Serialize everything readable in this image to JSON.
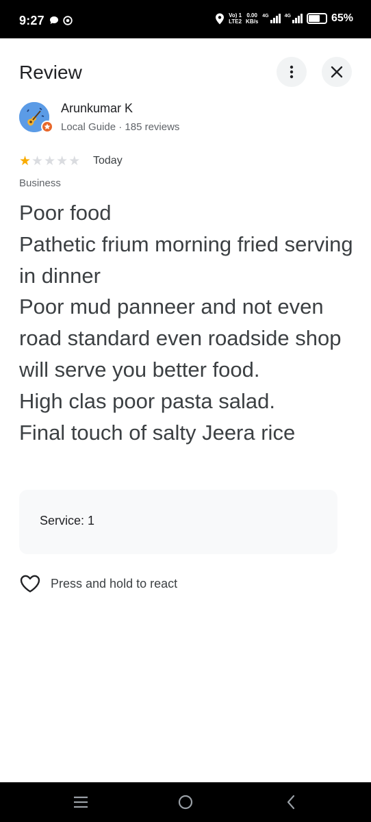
{
  "status_bar": {
    "time": "9:27",
    "volte_top": "Vo) 1",
    "volte_bottom": "LTE2",
    "speed_value": "0.00",
    "speed_unit": "KB/s",
    "net1": "4G",
    "net2": "4G",
    "battery_level": 0.65,
    "battery": "65%"
  },
  "header": {
    "title": "Review"
  },
  "author": {
    "name": "Arunkumar K",
    "meta": "Local Guide · 185 reviews"
  },
  "review": {
    "rating": 1,
    "max_rating": 5,
    "date": "Today",
    "visit_type": "Business",
    "text": "Poor food\nPathetic frium morning fried serving in dinner\nPoor mud panneer and not even road standard even roadside shop will serve you better food.\nHigh clas poor pasta salad.\nFinal touch of salty Jeera rice"
  },
  "attributes": {
    "service": "Service: 1"
  },
  "react": {
    "label": "Press and hold to react"
  },
  "colors": {
    "star_filled": "#f9ab00",
    "star_empty": "#dadce0",
    "badge": "#e8672a"
  },
  "icons": [
    "more-vert-icon",
    "close-icon",
    "heart-outline-icon",
    "menu-icon",
    "home-icon",
    "back-icon"
  ]
}
